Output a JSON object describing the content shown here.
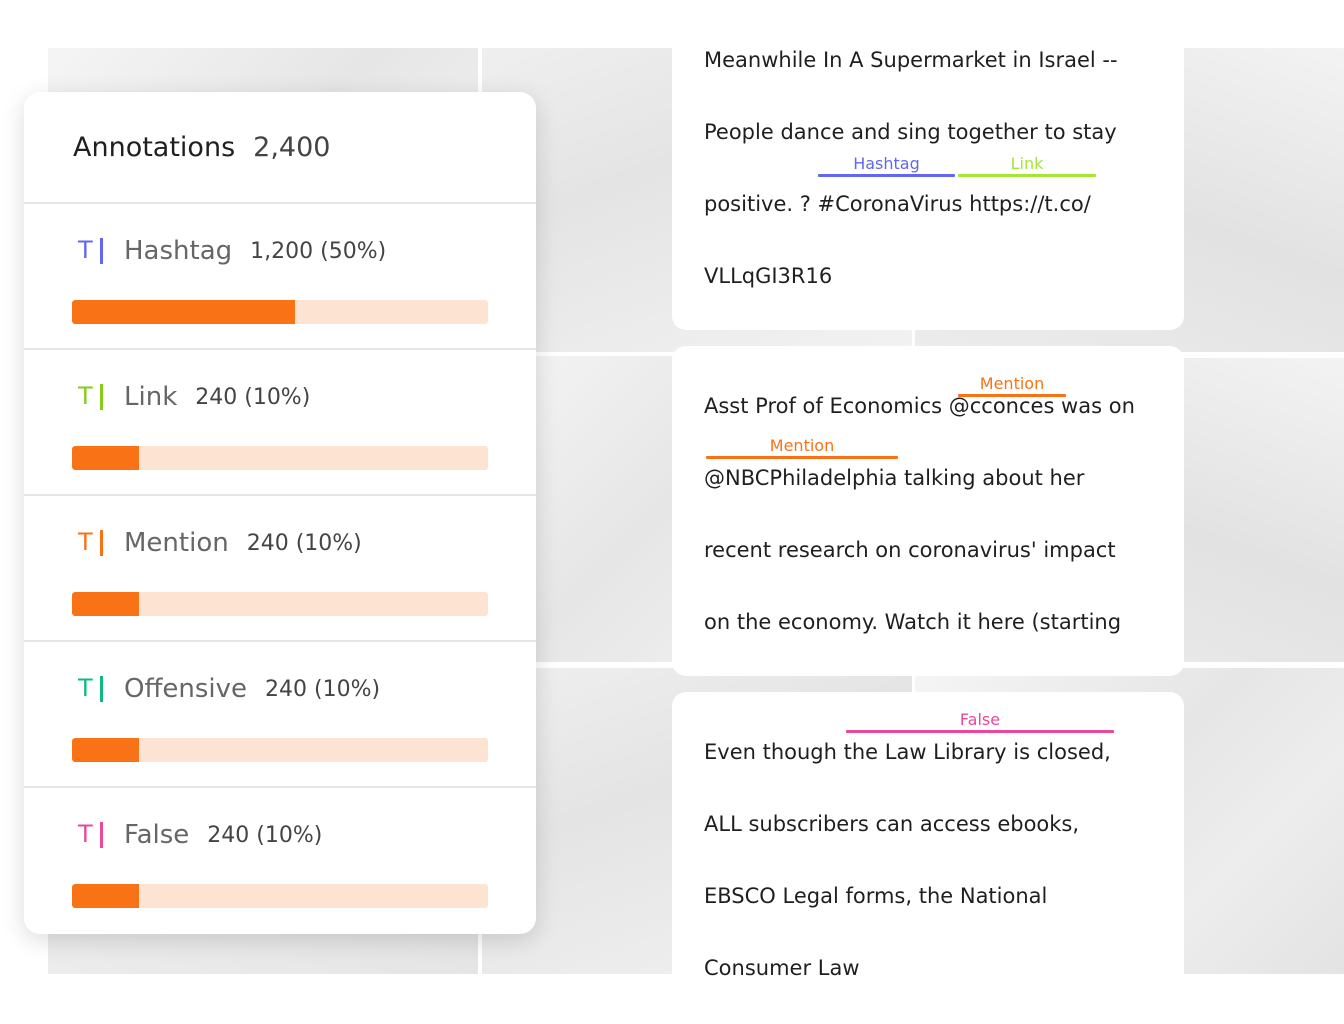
{
  "panel": {
    "title": "Annotations",
    "total": "2,400",
    "rows": [
      {
        "label": "Hashtag",
        "count": "1,200 (50%)",
        "color": "#6366f1",
        "fill_pct": 53.5
      },
      {
        "label": "Link",
        "count": "240 (10%)",
        "color": "#84cc16",
        "fill_pct": 16
      },
      {
        "label": "Mention",
        "count": "240 (10%)",
        "color": "#f97316",
        "fill_pct": 16
      },
      {
        "label": "Offensive",
        "count": "240 (10%)",
        "color": "#10b981",
        "fill_pct": 16
      },
      {
        "label": "False",
        "count": "240 (10%)",
        "color": "#ec4899",
        "fill_pct": 16
      }
    ],
    "icon_glyph": "T",
    "icon": "text-annotation-icon"
  },
  "cards": [
    {
      "lines": [
        "Meanwhile In A Supermarket in Israel --",
        "People dance and sing together to stay",
        "positive. ? #CoronaVirus https://t.co/",
        "VLLqGI3R16"
      ],
      "tags": [
        {
          "label": "Hashtag",
          "color": "#6366f1"
        },
        {
          "label": "Link",
          "color": "#a3e635"
        }
      ]
    },
    {
      "lines": [
        "Asst Prof of Economics @cconces was on",
        "@NBCPhiladelphia talking about her",
        "recent research on coronavirus' impact",
        "on the economy. Watch it here (starting"
      ],
      "tags": [
        {
          "label": "Mention",
          "color": "#f97316"
        },
        {
          "label": "Mention",
          "color": "#f97316"
        }
      ]
    },
    {
      "lines": [
        "Even though the Law Library is closed,",
        "ALL subscribers can access ebooks,",
        "EBSCO Legal forms, the National",
        "Consumer Law"
      ],
      "tags": [
        {
          "label": "False",
          "color": "#ec4899"
        }
      ]
    }
  ]
}
